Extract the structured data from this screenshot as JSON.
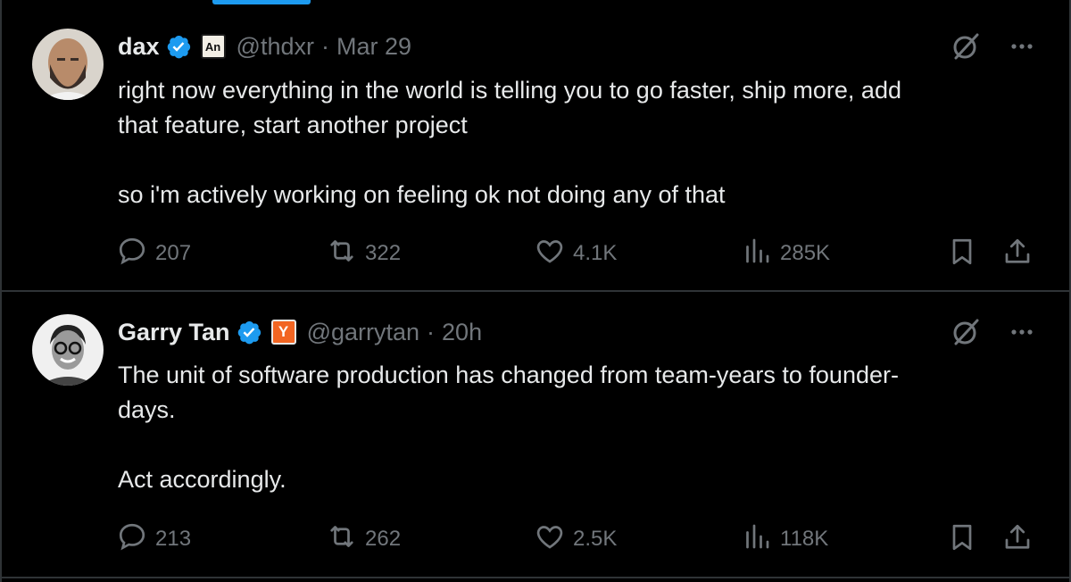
{
  "tweets": [
    {
      "name": "dax",
      "affiliate_badge": "An",
      "handle": "@thdxr",
      "time": "Mar 29",
      "text": "right now everything in the world is telling you to go faster, ship more, add\nthat feature, start another project\n\nso i'm actively working on feeling ok not doing any of that",
      "replies": "207",
      "reposts": "322",
      "likes": "4.1K",
      "views": "285K"
    },
    {
      "name": "Garry Tan",
      "affiliate_badge": "Y",
      "handle": "@garrytan",
      "time": "20h",
      "text": "The unit of software production has changed from team-years to founder-\ndays.\n\nAct accordingly.",
      "replies": "213",
      "reposts": "262",
      "likes": "2.5K",
      "views": "118K"
    }
  ],
  "separator": "·",
  "colors": {
    "background": "#000000",
    "text": "#e7e9ea",
    "muted": "#71767b",
    "verified": "#1d9bf0",
    "border": "#2f3336",
    "yc": "#f26522"
  },
  "icons": [
    "verified-badge-icon",
    "grok-icon",
    "more-icon",
    "reply-icon",
    "repost-icon",
    "like-icon",
    "views-icon",
    "bookmark-icon",
    "share-icon"
  ]
}
